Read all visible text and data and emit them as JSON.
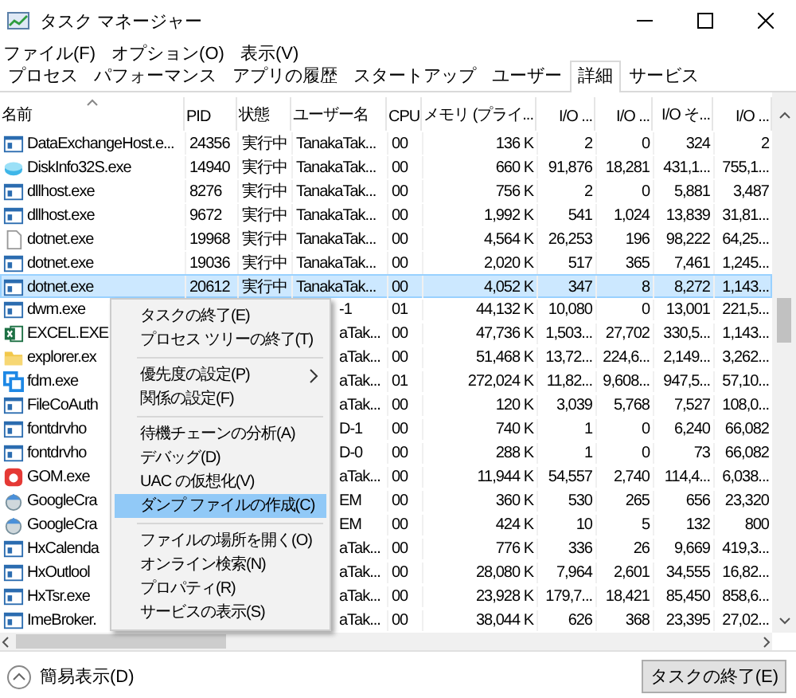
{
  "window": {
    "title": "タスク マネージャー"
  },
  "menu_bar": [
    "ファイル(F)",
    "オプション(O)",
    "表示(V)"
  ],
  "tabs": [
    {
      "label": "プロセス",
      "selected": false
    },
    {
      "label": "パフォーマンス",
      "selected": false
    },
    {
      "label": "アプリの履歴",
      "selected": false
    },
    {
      "label": "スタートアップ",
      "selected": false
    },
    {
      "label": "ユーザー",
      "selected": false
    },
    {
      "label": "詳細",
      "selected": true
    },
    {
      "label": "サービス",
      "selected": false
    }
  ],
  "table": {
    "columns": [
      {
        "label": "名前",
        "sorted": true
      },
      {
        "label": "PID",
        "sorted": false
      },
      {
        "label": "状態",
        "sorted": false
      },
      {
        "label": "ユーザー名",
        "sorted": false
      },
      {
        "label": "CPU",
        "sorted": false
      },
      {
        "label": "メモリ (プライ...",
        "sorted": false
      },
      {
        "label": "I/O ...",
        "sorted": false
      },
      {
        "label": "I/O ...",
        "sorted": false
      },
      {
        "label": "I/O そ...",
        "sorted": false
      },
      {
        "label": "I/O ...",
        "sorted": false
      }
    ],
    "rows": [
      {
        "kind": "app",
        "selected": false,
        "cells": [
          "DataExchangeHost.e...",
          "24356",
          "実行中",
          "TanakaTak...",
          "00",
          "136 K",
          "2",
          "0",
          "324",
          "2"
        ]
      },
      {
        "kind": "disk",
        "selected": false,
        "cells": [
          "DiskInfo32S.exe",
          "14940",
          "実行中",
          "TanakaTak...",
          "00",
          "660 K",
          "91,876",
          "18,281",
          "431,1...",
          "755,1..."
        ]
      },
      {
        "kind": "app",
        "selected": false,
        "cells": [
          "dllhost.exe",
          "8276",
          "実行中",
          "TanakaTak...",
          "00",
          "756 K",
          "2",
          "0",
          "5,881",
          "3,487"
        ]
      },
      {
        "kind": "app",
        "selected": false,
        "cells": [
          "dllhost.exe",
          "9672",
          "実行中",
          "TanakaTak...",
          "00",
          "1,992 K",
          "541",
          "1,024",
          "13,839",
          "31,81..."
        ]
      },
      {
        "kind": "file",
        "selected": false,
        "cells": [
          "dotnet.exe",
          "19968",
          "実行中",
          "TanakaTak...",
          "00",
          "4,564 K",
          "26,253",
          "196",
          "98,222",
          "64,25..."
        ]
      },
      {
        "kind": "app",
        "selected": false,
        "cells": [
          "dotnet.exe",
          "19036",
          "実行中",
          "TanakaTak...",
          "00",
          "2,020 K",
          "517",
          "365",
          "7,461",
          "1,245..."
        ]
      },
      {
        "kind": "app",
        "selected": true,
        "cells": [
          "dotnet.exe",
          "20612",
          "実行中",
          "TanakaTak...",
          "00",
          "4,052 K",
          "347",
          "8",
          "8,272",
          "1,143..."
        ]
      },
      {
        "kind": "app",
        "selected": false,
        "cells": [
          "dwm.exe",
          null,
          null,
          "-1",
          "01",
          "44,132 K",
          "10,080",
          "0",
          "13,001",
          "221,5..."
        ]
      },
      {
        "kind": "sheet",
        "selected": false,
        "cells": [
          "EXCEL.EXE",
          null,
          null,
          "aTak...",
          "00",
          "47,736 K",
          "1,503...",
          "27,702",
          "330,5...",
          "1,143..."
        ]
      },
      {
        "kind": "folder",
        "selected": false,
        "cells": [
          "explorer.ex",
          null,
          null,
          "aTak...",
          "00",
          "51,468 K",
          "13,72...",
          "224,6...",
          "2,149...",
          "3,262..."
        ]
      },
      {
        "kind": "sync",
        "selected": false,
        "cells": [
          "fdm.exe",
          null,
          null,
          "aTak...",
          "01",
          "272,024 K",
          "11,82...",
          "9,608...",
          "947,5...",
          "57,10..."
        ]
      },
      {
        "kind": "app",
        "selected": false,
        "cells": [
          "FileCoAuth",
          null,
          null,
          "aTak...",
          "00",
          "120 K",
          "3,039",
          "5,768",
          "7,527",
          "108,0..."
        ]
      },
      {
        "kind": "app",
        "selected": false,
        "cells": [
          "fontdrvho",
          null,
          null,
          "D-1",
          "00",
          "740 K",
          "1",
          "0",
          "6,240",
          "66,082"
        ]
      },
      {
        "kind": "app",
        "selected": false,
        "cells": [
          "fontdrvho",
          null,
          null,
          "D-0",
          "00",
          "288 K",
          "1",
          "0",
          "73",
          "66,082"
        ]
      },
      {
        "kind": "player",
        "selected": false,
        "cells": [
          "GOM.exe",
          null,
          null,
          "aTak...",
          "00",
          "11,944 K",
          "54,557",
          "2,740",
          "114,4...",
          "6,038..."
        ]
      },
      {
        "kind": "installer",
        "selected": false,
        "cells": [
          "GoogleCra",
          null,
          null,
          "EM",
          "00",
          "360 K",
          "530",
          "265",
          "656",
          "23,320"
        ]
      },
      {
        "kind": "installer",
        "selected": false,
        "cells": [
          "GoogleCra",
          null,
          null,
          "EM",
          "00",
          "424 K",
          "10",
          "5",
          "132",
          "800"
        ]
      },
      {
        "kind": "app",
        "selected": false,
        "cells": [
          "HxCalenda",
          null,
          null,
          "aTak...",
          "00",
          "776 K",
          "336",
          "26",
          "9,669",
          "419,3..."
        ]
      },
      {
        "kind": "app",
        "selected": false,
        "cells": [
          "HxOutlool",
          null,
          null,
          "aTak...",
          "00",
          "28,080 K",
          "7,964",
          "2,601",
          "34,555",
          "16,82..."
        ]
      },
      {
        "kind": "app",
        "selected": false,
        "cells": [
          "HxTsr.exe",
          null,
          null,
          "aTak...",
          "00",
          "23,928 K",
          "179,7...",
          "18,421",
          "85,450",
          "858,6..."
        ]
      },
      {
        "kind": "app",
        "selected": false,
        "cells": [
          "ImeBroker.",
          null,
          null,
          "aTak...",
          "00",
          "38,044 K",
          "626",
          "368",
          "23,395",
          "27,02..."
        ]
      }
    ]
  },
  "context_menu": [
    {
      "kind": "item",
      "label": "タスクの終了(E)",
      "highlighted": false,
      "submenu": false
    },
    {
      "kind": "item",
      "label": "プロセス ツリーの終了(T)",
      "highlighted": false,
      "submenu": false
    },
    {
      "kind": "separator"
    },
    {
      "kind": "item",
      "label": "優先度の設定(P)",
      "highlighted": false,
      "submenu": true
    },
    {
      "kind": "item",
      "label": "関係の設定(F)",
      "highlighted": false,
      "submenu": false
    },
    {
      "kind": "separator"
    },
    {
      "kind": "item",
      "label": "待機チェーンの分析(A)",
      "highlighted": false,
      "submenu": false
    },
    {
      "kind": "item",
      "label": "デバッグ(D)",
      "highlighted": false,
      "submenu": false
    },
    {
      "kind": "item",
      "label": "UAC の仮想化(V)",
      "highlighted": false,
      "submenu": false
    },
    {
      "kind": "item",
      "label": "ダンプ ファイルの作成(C)",
      "highlighted": true,
      "submenu": false
    },
    {
      "kind": "separator"
    },
    {
      "kind": "item",
      "label": "ファイルの場所を開く(O)",
      "highlighted": false,
      "submenu": false
    },
    {
      "kind": "item",
      "label": "オンライン検索(N)",
      "highlighted": false,
      "submenu": false
    },
    {
      "kind": "item",
      "label": "プロパティ(R)",
      "highlighted": false,
      "submenu": false
    },
    {
      "kind": "item",
      "label": "サービスの表示(S)",
      "highlighted": false,
      "submenu": false
    }
  ],
  "footer": {
    "toggle": "簡易表示(D)",
    "button": "タスクの終了(E)"
  }
}
